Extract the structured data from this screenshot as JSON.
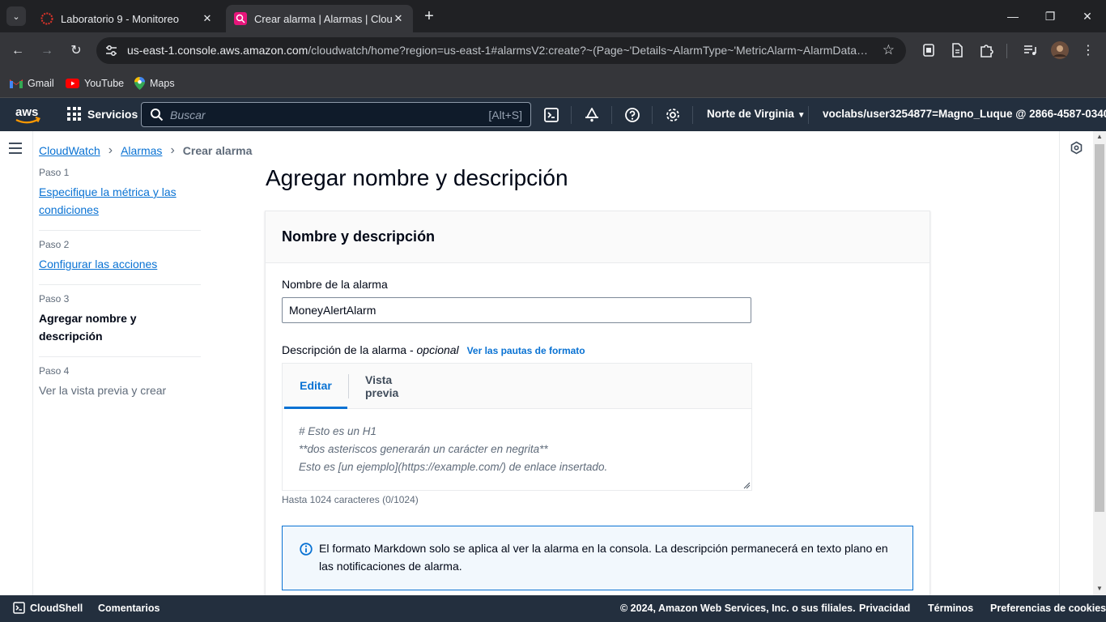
{
  "browser": {
    "tabs": [
      {
        "title": "Laboratorio 9 - Monitoreo",
        "active": false
      },
      {
        "title": "Crear alarma | Alarmas | CloudWatch",
        "active": true
      }
    ],
    "address_host": "us-east-1.console.aws.amazon.com",
    "address_path": "/cloudwatch/home?region=us-east-1#alarmsV2:create?~(Page~'Details~AlarmType~'MetricAlarm~AlarmData~(...",
    "bookmarks": [
      "Gmail",
      "YouTube",
      "Maps"
    ]
  },
  "aws_nav": {
    "services_label": "Servicios",
    "search_placeholder": "Buscar",
    "search_shortcut": "[Alt+S]",
    "region": "Norte de Virginia",
    "account": "voclabs/user3254877=Magno_Luque @ 2866-4587-0340"
  },
  "breadcrumb": {
    "items": [
      "CloudWatch",
      "Alarmas"
    ],
    "current": "Crear alarma"
  },
  "steps": [
    {
      "num": "Paso 1",
      "label": "Especifique la métrica y las condiciones",
      "state": "link"
    },
    {
      "num": "Paso 2",
      "label": "Configurar las acciones",
      "state": "link"
    },
    {
      "num": "Paso 3",
      "label": "Agregar nombre y descripción",
      "state": "current"
    },
    {
      "num": "Paso 4",
      "label": "Ver la vista previa y crear",
      "state": "disabled"
    }
  ],
  "main": {
    "title": "Agregar nombre y descripción",
    "section_title": "Nombre y descripción",
    "name_label": "Nombre de la alarma",
    "name_value": "MoneyAlertAlarm",
    "desc_label": "Descripción de la alarma - ",
    "desc_optional": "opcional",
    "format_link": "Ver las pautas de formato",
    "editor_tabs": [
      "Editar",
      "Vista previa"
    ],
    "editor_placeholder_lines": [
      "# Esto es un H1",
      "**dos asteriscos generarán un carácter en negrita**",
      "Esto es [un ejemplo](https://example.com/) de enlace insertado."
    ],
    "char_hint": "Hasta 1024 caracteres (0/1024)",
    "info_text": "El formato Markdown solo se aplica al ver la alarma en la consola. La descripción permanecerá en texto plano en las notificaciones de alarma."
  },
  "footer": {
    "cloudshell": "CloudShell",
    "comments": "Comentarios",
    "copyright": "© 2024, Amazon Web Services, Inc. o sus filiales.",
    "links": [
      "Privacidad",
      "Términos",
      "Preferencias de cookies"
    ]
  },
  "colors": {
    "aws_nav": "#232f3e",
    "link": "#0972d3",
    "info_bg": "#f2f8fd"
  }
}
